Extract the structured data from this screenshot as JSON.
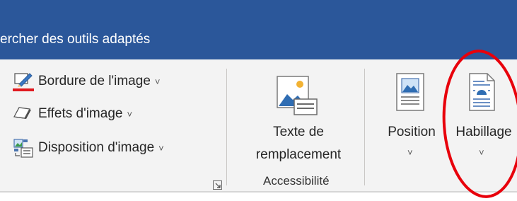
{
  "search": {
    "text": "ercher des outils adaptés"
  },
  "picture_styles": {
    "border": {
      "label": "Bordure de l'image",
      "icon": "picture-border-icon",
      "color": "#e0191f"
    },
    "effects": {
      "label": "Effets d'image",
      "icon": "picture-effects-icon"
    },
    "layout": {
      "label": "Disposition d'image",
      "icon": "picture-layout-icon"
    },
    "launcher_icon": "dialog-launcher-icon",
    "dropdown_glyph": "˅"
  },
  "accessibility": {
    "alt_text_line1": "Texte de",
    "alt_text_line2": "remplacement",
    "alt_text_icon": "alt-text-icon",
    "group_label": "Accessibilité"
  },
  "arrange": {
    "position": {
      "label": "Position",
      "icon": "position-icon"
    },
    "wrap": {
      "label": "Habillage",
      "icon": "wrap-text-icon"
    }
  },
  "colors": {
    "title_bar": "#2b579a",
    "ribbon": "#f3f3f3",
    "annotation": "#e8000b"
  }
}
